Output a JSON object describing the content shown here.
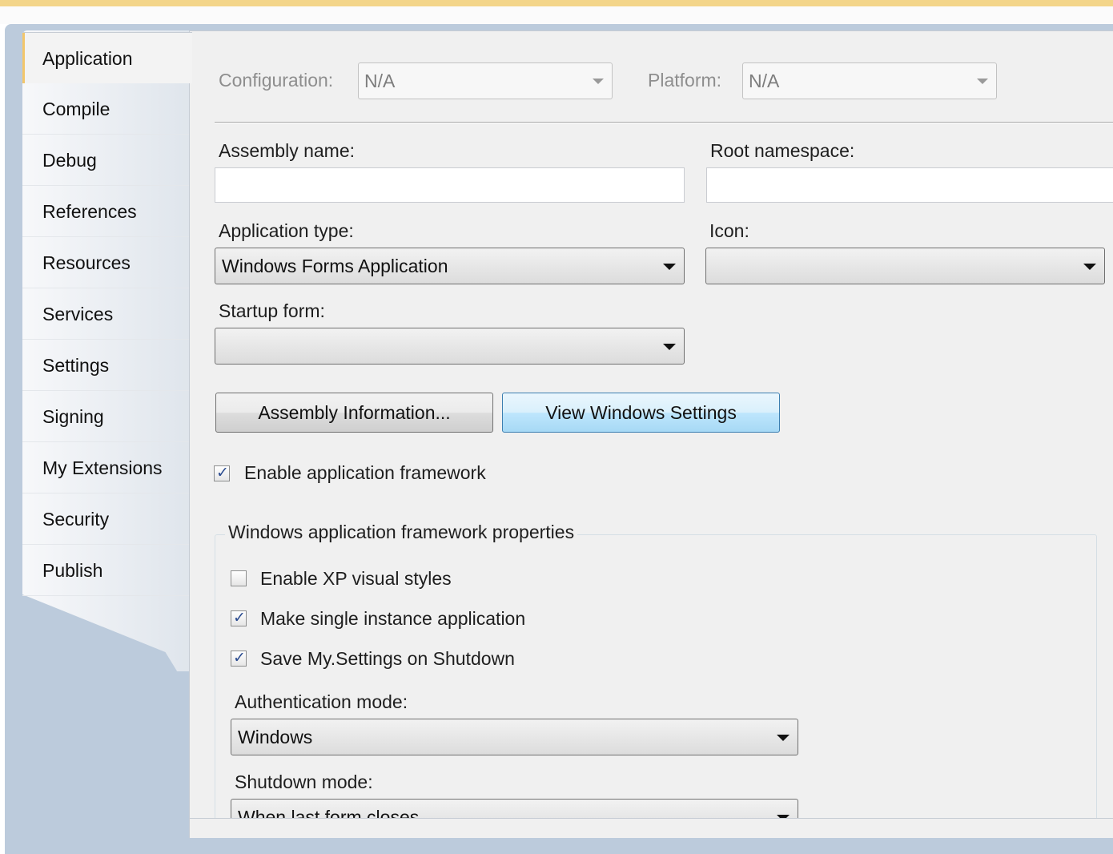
{
  "tabs": [
    {
      "label": "Application",
      "active": true
    },
    {
      "label": "Compile"
    },
    {
      "label": "Debug"
    },
    {
      "label": "References"
    },
    {
      "label": "Resources"
    },
    {
      "label": "Services"
    },
    {
      "label": "Settings"
    },
    {
      "label": "Signing"
    },
    {
      "label": "My Extensions"
    },
    {
      "label": "Security"
    },
    {
      "label": "Publish"
    }
  ],
  "config": {
    "configuration_label": "Configuration:",
    "configuration_value": "N/A",
    "platform_label": "Platform:",
    "platform_value": "N/A"
  },
  "fields": {
    "assembly_name_label": "Assembly name:",
    "assembly_name_value": "",
    "root_namespace_label": "Root namespace:",
    "root_namespace_value": "",
    "application_type_label": "Application type:",
    "application_type_value": "Windows Forms Application",
    "icon_label": "Icon:",
    "icon_value": "",
    "startup_form_label": "Startup form:",
    "startup_form_value": ""
  },
  "buttons": {
    "assembly_information": "Assembly Information...",
    "view_windows_settings": "View Windows Settings"
  },
  "framework": {
    "enable_label": "Enable application framework",
    "enable_checked": true,
    "group_title": "Windows application framework properties",
    "xp_styles_label": "Enable XP visual styles",
    "xp_styles_checked": false,
    "single_instance_label": "Make single instance application",
    "single_instance_checked": true,
    "save_settings_label": "Save My.Settings on Shutdown",
    "save_settings_checked": true,
    "auth_mode_label": "Authentication mode:",
    "auth_mode_value": "Windows",
    "shutdown_mode_label": "Shutdown mode:",
    "shutdown_mode_value": "When last form closes"
  },
  "colors": {
    "frame": "#bccbdc",
    "content": "#f0f0f0",
    "active_tab_accent": "#f2c66b",
    "focused_button": "#bee6fd"
  }
}
